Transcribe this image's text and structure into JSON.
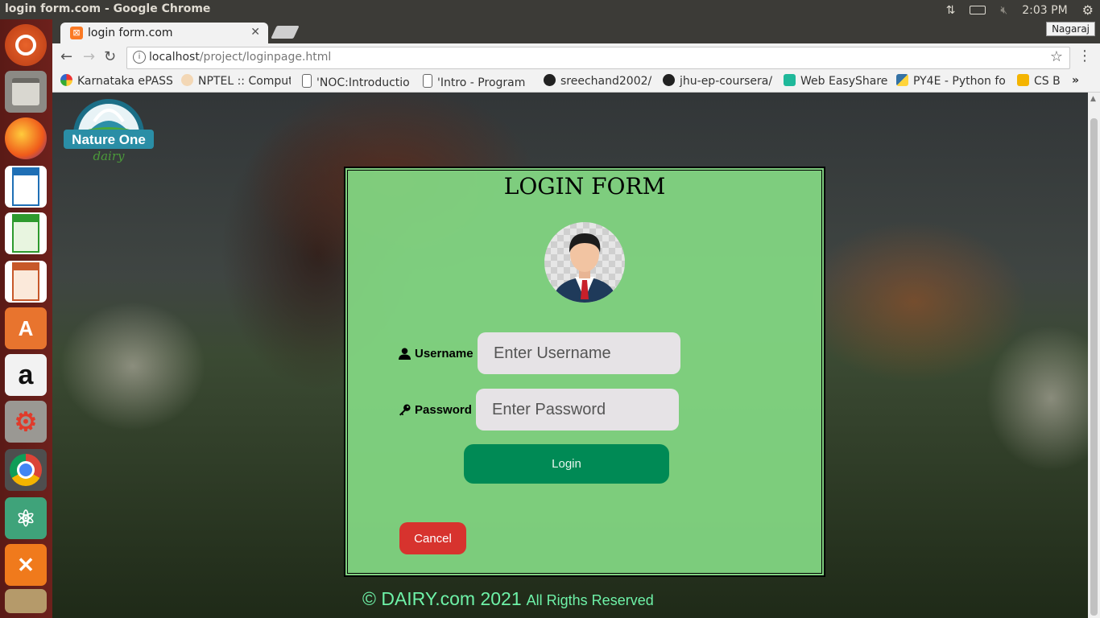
{
  "os": {
    "window_title": "login form.com - Google Chrome",
    "time": "2:03 PM",
    "user": "Nagaraj"
  },
  "launcher": {
    "items": [
      "ubuntu-dash",
      "files",
      "firefox",
      "writer",
      "calc",
      "impress",
      "software-center",
      "amazon",
      "system-settings",
      "chrome",
      "atom",
      "xampp",
      "trash"
    ]
  },
  "browser": {
    "tab_title": "login form.com",
    "url_host": "localhost",
    "url_path": "/project/loginpage.html",
    "bookmarks": [
      "Karnataka ePASS",
      "NPTEL :: Comput",
      "'NOC:Introductio",
      "'Intro - Program",
      "sreechand2002/",
      "jhu-ep-coursera/",
      "Web EasyShare",
      "PY4E - Python fo",
      "CS B"
    ],
    "overflow": "»"
  },
  "page": {
    "logo_text_line1": "Nature One",
    "logo_text_line2": "dairy",
    "form_title": "LOGIN FORM",
    "username_label": "Username",
    "username_placeholder": "Enter Username",
    "password_label": "Password",
    "password_placeholder": "Enter Password",
    "login_button": "Login",
    "cancel_button": "Cancel",
    "footer_main": "© DAIRY.com 2021",
    "footer_small": "All Rigths Reserved",
    "colors": {
      "form_bg": "#83d883",
      "login_btn": "#008a55",
      "cancel_btn": "#d7332e",
      "footer_text": "#6ef2a8"
    }
  }
}
